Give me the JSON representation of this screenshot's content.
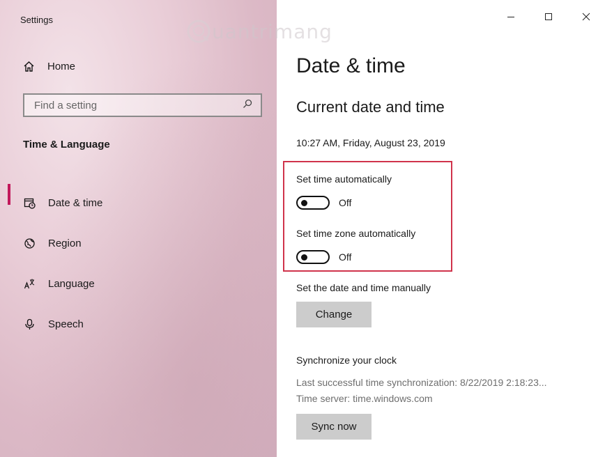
{
  "window": {
    "title": "Settings"
  },
  "watermark": {
    "text": "uantrimang"
  },
  "sidebar": {
    "home_label": "Home",
    "search_placeholder": "Find a setting",
    "section_title": "Time & Language",
    "items": [
      {
        "label": "Date & time",
        "icon": "calendar-clock-icon",
        "selected": true
      },
      {
        "label": "Region",
        "icon": "globe-icon",
        "selected": false
      },
      {
        "label": "Language",
        "icon": "language-icon",
        "selected": false
      },
      {
        "label": "Speech",
        "icon": "microphone-icon",
        "selected": false
      }
    ]
  },
  "main": {
    "page_title": "Date & time",
    "section_title": "Current date and time",
    "current_datetime": "10:27 AM, Friday, August 23, 2019",
    "set_time_auto": {
      "label": "Set time automatically",
      "state": "Off"
    },
    "set_timezone_auto": {
      "label": "Set time zone automatically",
      "state": "Off"
    },
    "manual": {
      "label": "Set the date and time manually",
      "button": "Change"
    },
    "sync": {
      "title": "Synchronize your clock",
      "last_sync": "Last successful time synchronization: 8/22/2019 2:18:23...",
      "time_server": "Time server: time.windows.com",
      "button": "Sync now"
    }
  },
  "colors": {
    "accent": "#c2185b",
    "highlight_box": "#d0334b",
    "button_gray": "#cccccc"
  }
}
